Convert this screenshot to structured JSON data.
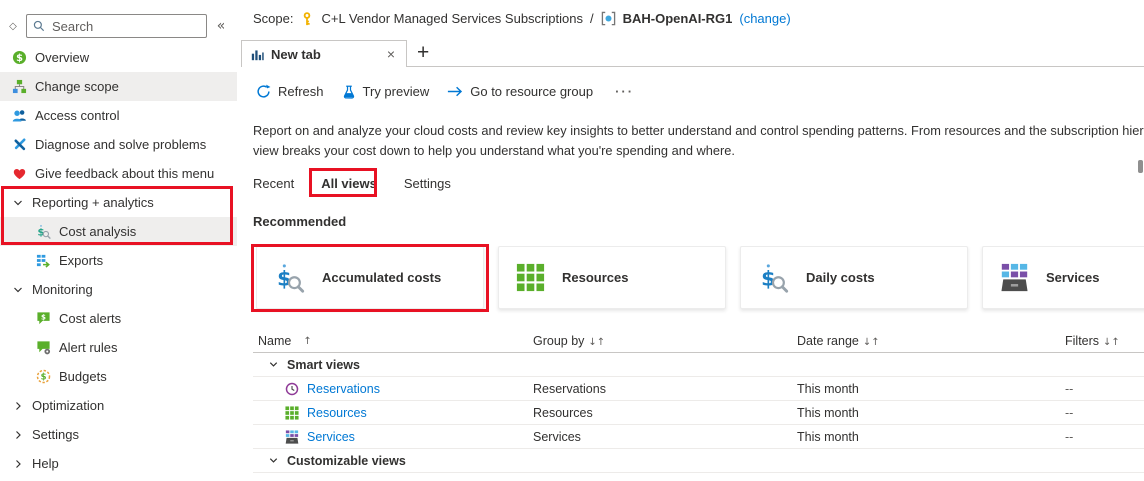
{
  "sidebar": {
    "dock_icon": "◇",
    "collapse_icon": "«",
    "search": {
      "placeholder": "Search"
    },
    "items": [
      {
        "label": "Overview",
        "icon": "cost-management",
        "selected": false
      },
      {
        "label": "Change scope",
        "icon": "change-scope",
        "selected": true
      },
      {
        "label": "Access control",
        "icon": "access-control"
      },
      {
        "label": "Diagnose and solve problems",
        "icon": "tools"
      },
      {
        "label": "Give feedback about this menu",
        "icon": "heart"
      },
      {
        "label": "Reporting + analytics",
        "icon": "chevron-down",
        "group": true,
        "expanded": true
      },
      {
        "label": "Cost analysis",
        "icon": "cost-analysis",
        "sub": true,
        "selected": true
      },
      {
        "label": "Exports",
        "icon": "exports",
        "sub": true
      },
      {
        "label": "Monitoring",
        "icon": "chevron-down",
        "group": true,
        "expanded": true
      },
      {
        "label": "Cost alerts",
        "icon": "cost-alerts",
        "sub": true
      },
      {
        "label": "Alert rules",
        "icon": "alert-rules",
        "sub": true
      },
      {
        "label": "Budgets",
        "icon": "budgets",
        "sub": true
      },
      {
        "label": "Optimization",
        "icon": "chevron-right",
        "group": true,
        "expanded": false
      },
      {
        "label": "Settings",
        "icon": "chevron-right",
        "group": true,
        "expanded": false
      },
      {
        "label": "Help",
        "icon": "chevron-right",
        "group": true,
        "expanded": false
      }
    ]
  },
  "scope": {
    "label": "Scope:",
    "subscription": "C+L Vendor Managed Services Subscriptions",
    "separator": "/",
    "resource_group": "BAH-OpenAI-RG1",
    "change_link": "(change)"
  },
  "tab_bar": {
    "active_tab": "New tab",
    "close": "×",
    "add": "+"
  },
  "toolbar": {
    "refresh": "Refresh",
    "try_preview": "Try preview",
    "go_to_resource_group": "Go to resource group",
    "more": "···"
  },
  "description": {
    "line1": "Report on and analyze your cloud costs and review key insights to better understand and control spending patterns. From resources and the subscription hierarchy to the pro",
    "line2": "view breaks your cost down to help you understand what you're spending and where."
  },
  "view_tabs": {
    "recent": "Recent",
    "all_views": "All views",
    "settings": "Settings"
  },
  "recommended": {
    "heading": "Recommended",
    "cards": [
      {
        "label": "Accumulated costs",
        "icon": "dollar-magnifier",
        "highlighted": true
      },
      {
        "label": "Resources",
        "icon": "resources-grid"
      },
      {
        "label": "Daily costs",
        "icon": "dollar-magnifier"
      },
      {
        "label": "Services",
        "icon": "services-grid"
      }
    ]
  },
  "views_table": {
    "columns": [
      {
        "label": "Name",
        "sort": "↑"
      },
      {
        "label": "Group by",
        "sort": "↓↑"
      },
      {
        "label": "Date range",
        "sort": "↓↑"
      },
      {
        "label": "Filters",
        "sort": "↓↑"
      }
    ],
    "groups": [
      {
        "label": "Smart views",
        "rows": [
          {
            "name": "Reservations",
            "icon": "clock",
            "group_by": "Reservations",
            "date_range": "This month",
            "filters": "--"
          },
          {
            "name": "Resources",
            "icon": "resources-grid",
            "group_by": "Resources",
            "date_range": "This month",
            "filters": "--"
          },
          {
            "name": "Services",
            "icon": "services-grid",
            "group_by": "Services",
            "date_range": "This month",
            "filters": "--"
          }
        ]
      },
      {
        "label": "Customizable views",
        "rows": []
      }
    ]
  },
  "colors": {
    "accent": "#0078d4",
    "annotation_red": "#e81123",
    "selected_row_bg": "#efeeed",
    "green": "#5aaf2b",
    "text": "#323130"
  }
}
